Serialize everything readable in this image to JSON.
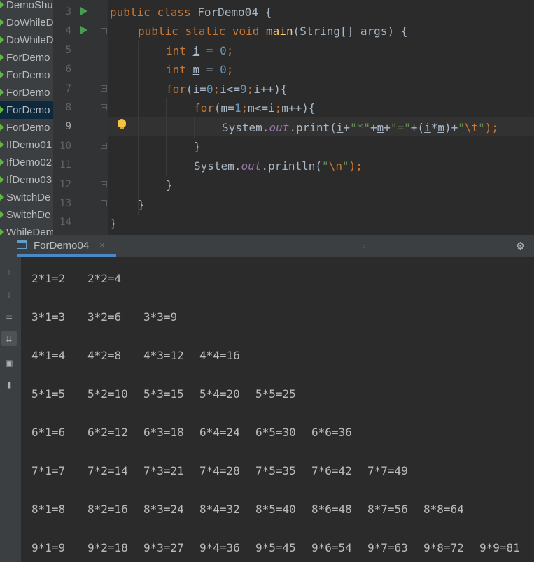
{
  "project_files": [
    "DemoShu",
    "DoWhileD",
    "DoWhileD",
    "ForDemo",
    "ForDemo",
    "ForDemo",
    "ForDemo",
    "ForDemo",
    "IfDemo01",
    "IfDemo02",
    "IfDemo03",
    "SwitchDe",
    "SwitchDe",
    "WhileDem"
  ],
  "selected_file_index": 6,
  "line_numbers": [
    "3",
    "4",
    "5",
    "6",
    "7",
    "8",
    "9",
    "10",
    "11",
    "12",
    "13",
    "14"
  ],
  "current_line": "9",
  "code": {
    "l3": {
      "kw1": "public",
      "kw2": "class",
      "name": "ForDemo04",
      "brace": " {"
    },
    "l4": {
      "kw1": "public",
      "kw2": "static",
      "kw3": "void",
      "fn": "main",
      "rest": "(String[] args) {"
    },
    "l5": {
      "kw": "int",
      "var": "i",
      "eq": " = ",
      "num": "0",
      "end": ";"
    },
    "l6": {
      "kw": "int",
      "var": "m",
      "eq": " = ",
      "num": "0",
      "end": ";"
    },
    "l7": {
      "kw": "for",
      "p1": "(",
      "v1": "i",
      "op1": "=",
      "n1": "0",
      "s1": ";",
      "v2": "i",
      "op2": "<=",
      "n2": "9",
      "s2": ";",
      "v3": "i",
      "op3": "++){"
    },
    "l8": {
      "kw": "for",
      "p1": "(",
      "v1": "m",
      "op1": "=",
      "n1": "1",
      "s1": ";",
      "v2": "m",
      "op2": "<=",
      "v3": "i",
      "s2": ";",
      "v4": "m",
      "op3": "++){"
    },
    "l9": {
      "cls": "System.",
      "fld": "out",
      "call": ".print(",
      "v1": "i",
      "p1": "+",
      "s1": "\"*\"",
      "p2": "+",
      "v2": "m",
      "p3": "+",
      "s2": "\"=\"",
      "p4": "+(",
      "v3": "i",
      "p5": "*",
      "v4": "m",
      "p6": ")+",
      "s3a": "\"",
      "esc": "\\t",
      "s3b": "\"",
      "end": ");"
    },
    "l10": "}",
    "l11": {
      "cls": "System.",
      "fld": "out",
      "call": ".println(",
      "s1a": "\"",
      "esc": "\\n",
      "s1b": "\"",
      "end": ");"
    },
    "l12": "}",
    "l13": "}",
    "l14": "}"
  },
  "run_panel": {
    "tab_label": "ForDemo04",
    "tab_close": "×",
    "drag_handle": "⋮",
    "settings_icon": "gear-icon"
  },
  "toolbar_icons": [
    "arrow-up-icon",
    "arrow-down-icon",
    "soft-wrap-icon",
    "scroll-to-end-icon",
    "print-icon",
    "trash-icon"
  ],
  "console_output": [
    [
      "2*1=2",
      "2*2=4"
    ],
    [
      "3*1=3",
      "3*2=6",
      "3*3=9"
    ],
    [
      "4*1=4",
      "4*2=8",
      "4*3=12",
      "4*4=16"
    ],
    [
      "5*1=5",
      "5*2=10",
      "5*3=15",
      "5*4=20",
      "5*5=25"
    ],
    [
      "6*1=6",
      "6*2=12",
      "6*3=18",
      "6*4=24",
      "6*5=30",
      "6*6=36"
    ],
    [
      "7*1=7",
      "7*2=14",
      "7*3=21",
      "7*4=28",
      "7*5=35",
      "7*6=42",
      "7*7=49"
    ],
    [
      "8*1=8",
      "8*2=16",
      "8*3=24",
      "8*4=32",
      "8*5=40",
      "8*6=48",
      "8*7=56",
      "8*8=64"
    ],
    [
      "9*1=9",
      "9*2=18",
      "9*3=27",
      "9*4=36",
      "9*5=45",
      "9*6=54",
      "9*7=63",
      "9*8=72",
      "9*9=81"
    ]
  ],
  "colors": {
    "keyword": "#cc7832",
    "method": "#ffc66d",
    "number": "#6897bb",
    "string": "#6a8759",
    "field": "#9876aa",
    "text": "#a9b7c6",
    "selection": "#0d293e",
    "tab_accent": "#4a88c7",
    "run_green": "#499c54"
  }
}
